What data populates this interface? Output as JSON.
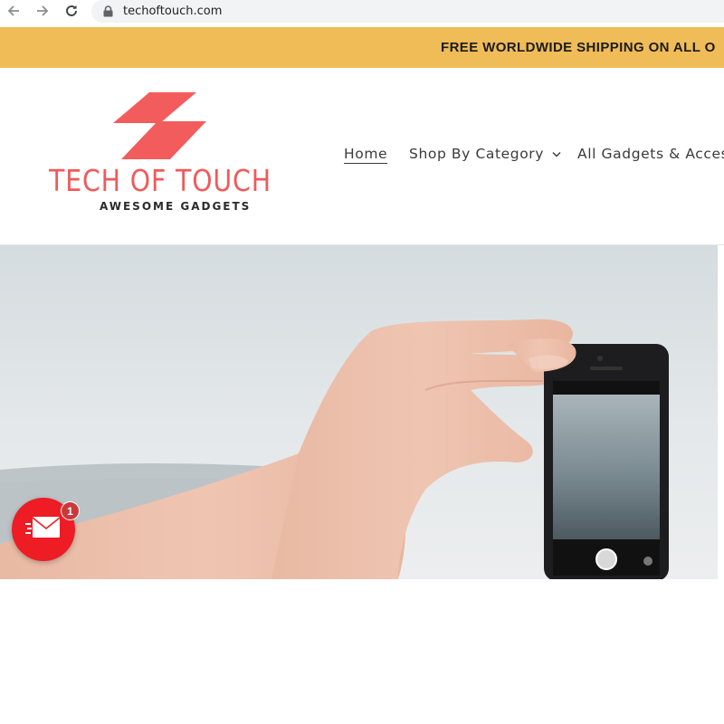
{
  "browser": {
    "url": "techoftouch.com",
    "icons": [
      "back-arrow-icon",
      "forward-arrow-icon",
      "reload-icon",
      "lock-icon"
    ]
  },
  "announcement": {
    "text": "FREE WORLDWIDE SHIPPING ON ALL O",
    "background_color": "#efbc57"
  },
  "header": {
    "logo": {
      "title": "TECH OF TOUCH",
      "tagline": "AWESOME GADGETS",
      "brand_color": "#f05a5b"
    },
    "nav": {
      "home": "Home",
      "shop_by_category": "Shop By Category",
      "all_gadgets": "All Gadgets & Acces"
    }
  },
  "chat_widget": {
    "badge_count": "1",
    "icon": "envelope-icon",
    "color": "#ee1c24"
  }
}
